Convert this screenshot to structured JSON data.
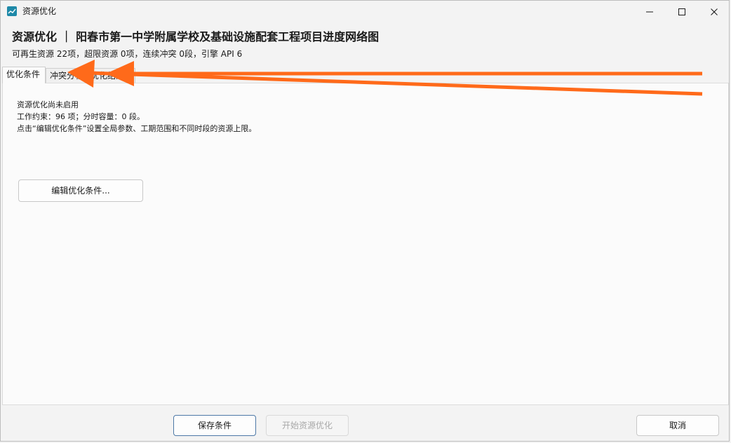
{
  "window": {
    "title": "资源优化",
    "icon": "chart-line-icon"
  },
  "header": {
    "title": "资源优化 ｜ 阳春市第一中学附属学校及基础设施配套工程项目进度网络图",
    "subtitle": "可再生资源 22项，超限资源 0项，连续冲突 0段，引擎 API 6"
  },
  "tabs": [
    {
      "label": "优化条件",
      "active": true
    },
    {
      "label": "冲突分析",
      "active": false
    },
    {
      "label": "优化结果",
      "active": false
    }
  ],
  "panel": {
    "lines": [
      "资源优化尚未启用",
      "工作约束：96 项；分时容量：0 段。",
      "点击“编辑优化条件”设置全局参数、工期范围和不同时段的资源上限。"
    ],
    "edit_button": "编辑优化条件..."
  },
  "footer": {
    "save_label": "保存条件",
    "start_label": "开始资源优化",
    "cancel_label": "取消"
  },
  "colors": {
    "annotation_arrow": "#ff6a1a",
    "primary_border": "#4d78a6",
    "icon_teal": "#1e89a8"
  }
}
